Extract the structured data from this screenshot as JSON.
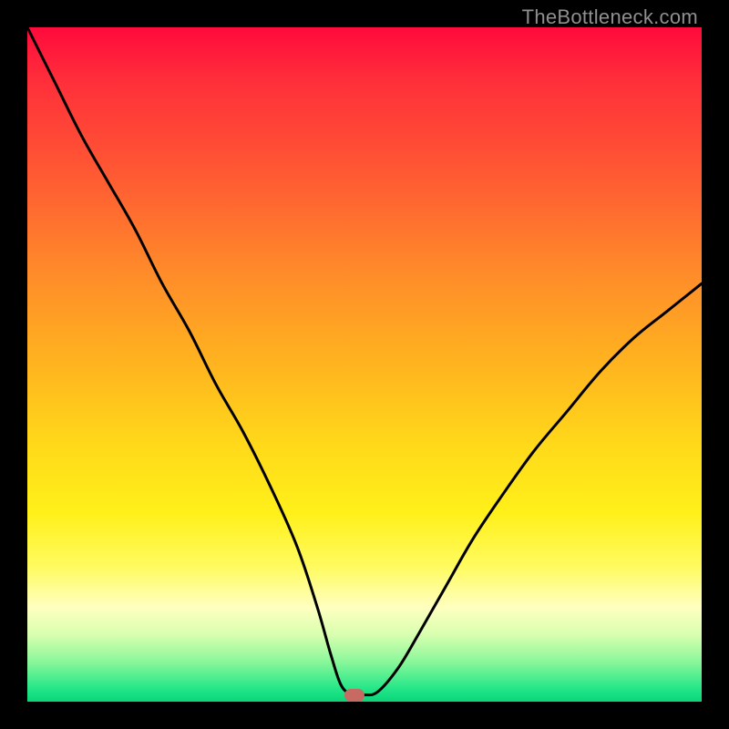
{
  "watermark": "TheBottleneck.com",
  "colors": {
    "frame": "#000000",
    "gradient_top": "#ff0a3c",
    "gradient_mid": "#ffd91a",
    "gradient_bottom": "#09d57a",
    "curve": "#000000",
    "marker": "#c66a63"
  },
  "chart_data": {
    "type": "line",
    "title": "",
    "xlabel": "",
    "ylabel": "",
    "xlim": [
      0,
      100
    ],
    "ylim": [
      0,
      100
    ],
    "grid": false,
    "legend": null,
    "series": [
      {
        "name": "bottleneck-curve",
        "x": [
          0,
          4,
          8,
          12,
          16,
          20,
          24,
          28,
          32,
          36,
          40,
          43,
          45,
          46.5,
          48,
          50,
          52,
          55,
          58,
          62,
          66,
          70,
          75,
          80,
          85,
          90,
          95,
          100
        ],
        "y": [
          100,
          92,
          84,
          77,
          70,
          62,
          55,
          47,
          40,
          32,
          23,
          14,
          7,
          2.5,
          1.2,
          1.0,
          1.5,
          5,
          10,
          17,
          24,
          30,
          37,
          43,
          49,
          54,
          58,
          62
        ]
      }
    ],
    "marker": {
      "x": 48.5,
      "y": 1.0
    },
    "notes": "V-shaped bottleneck chart; value 0 (green band at bottom) is the optimum, 100 (red top) is worst. Minimum around x≈48."
  }
}
